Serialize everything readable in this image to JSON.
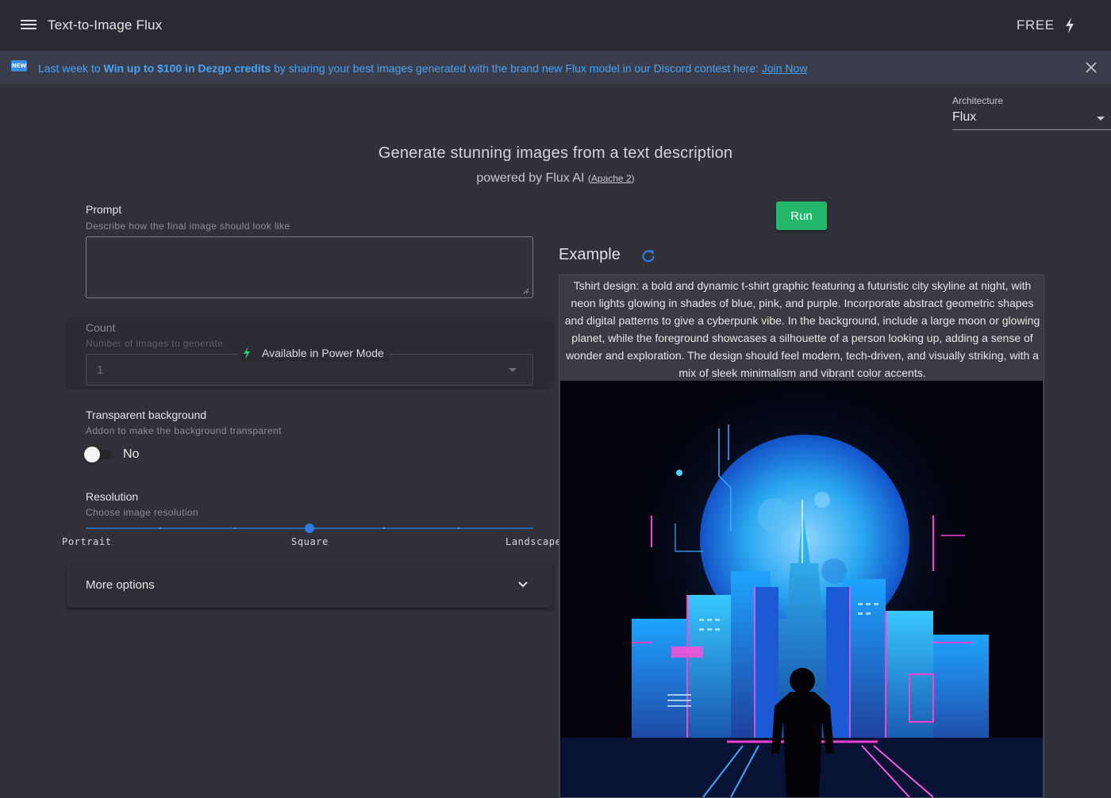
{
  "appbar": {
    "title": "Text-to-Image Flux",
    "plan": "FREE",
    "menu_icon": "hamburger-menu-icon",
    "plan_icon": "lightning-bolt-icon"
  },
  "banner": {
    "badge": "NEW",
    "text_before": "Last week to ",
    "text_bold": "Win up to $100 in Dezgo credits",
    "text_after": " by sharing your best images generated with the brand new Flux model in our Discord contest here: ",
    "link": "Join Now",
    "close_icon": "close-icon",
    "color": "#4aa3f4"
  },
  "architecture": {
    "label": "Architecture",
    "value": "Flux"
  },
  "header": {
    "title": "Generate stunning images from a text description",
    "subtitle": "powered by Flux AI",
    "license_open": "(",
    "license": "Apache 2",
    "license_close": ")"
  },
  "form": {
    "prompt": {
      "label": "Prompt",
      "hint": "Describe how the final image should look like",
      "value": ""
    },
    "count": {
      "label": "Count",
      "hint": "Number of images to generate",
      "value": "1",
      "power_mode": "Available in Power Mode"
    },
    "transparent": {
      "label": "Transparent background",
      "hint": "Addon to make the background transparent",
      "state": "No",
      "enabled": false
    },
    "resolution": {
      "label": "Resolution",
      "hint": "Choose image resolution",
      "options": [
        "Portrait",
        "Square",
        "Landscape"
      ],
      "selected": "Square",
      "position": 0.5
    },
    "more_options": "More options"
  },
  "run_button": "Run",
  "example": {
    "title": "Example",
    "refresh_icon": "refresh-icon",
    "prompt": "Tshirt design: a bold and dynamic t-shirt graphic featuring a futuristic city skyline at night, with neon lights glowing in shades of blue, pink, and purple. Incorporate abstract geometric shapes and digital patterns to give a cyberpunk vibe. In the background, include a large moon or glowing planet, while the foreground showcases a silhouette of a person looking up, adding a sense of wonder and exploration. The design should feel modern, tech-driven, and visually striking, with a mix of sleek minimalism and vibrant color accents."
  },
  "colors": {
    "background": "#303139",
    "appbar": "#2a2b32",
    "accent_blue": "#2f7be0",
    "run_green": "#25b76c",
    "power_green": "#2ecc71"
  }
}
